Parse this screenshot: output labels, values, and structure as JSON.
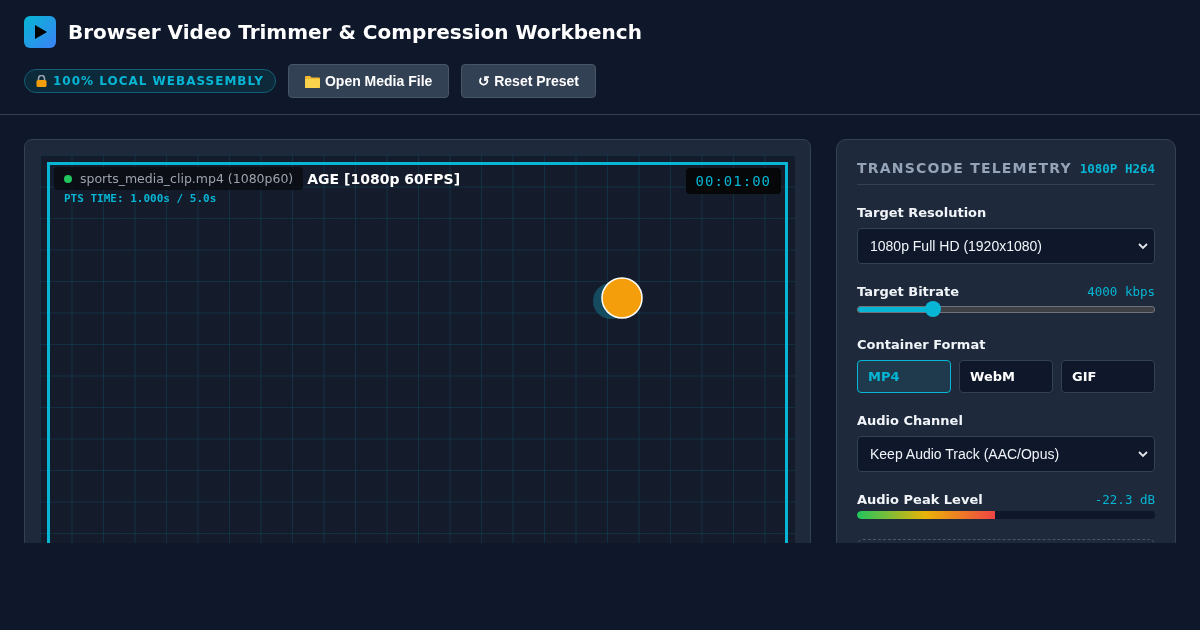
{
  "header": {
    "title": "Browser Video Trimmer & Compression Workbench",
    "badge": "100% LOCAL WEBASSEMBLY",
    "buttons": [
      {
        "kind": "open",
        "label": "Open Media File"
      },
      {
        "kind": "reset",
        "label": "↺ Reset Preset"
      }
    ]
  },
  "preview": {
    "filename": "sports_media_clip.mp4 (1080p60)",
    "caption_visible": "AGE [1080p 60FPS]",
    "pts": "PTS TIME: 1.000s / 5.0s",
    "timecode": "00:01:00"
  },
  "telemetry": {
    "title": "TRANSCODE TELEMETRY",
    "tag": "1080P H264",
    "resolution": {
      "label": "Target Resolution",
      "value": "1080p Full HD (1920x1080)"
    },
    "bitrate": {
      "label": "Target Bitrate",
      "reading": "4000 kbps",
      "level": 0.255
    },
    "container": {
      "label": "Container Format",
      "options": [
        {
          "label": "MP4",
          "selected": true
        },
        {
          "label": "WebM",
          "selected": false
        },
        {
          "label": "GIF",
          "selected": false
        }
      ]
    },
    "audio": {
      "label": "Audio Channel",
      "value": "Keep Audio Track (AAC/Opus)"
    },
    "peak": {
      "label": "Audio Peak Level",
      "reading": "-22.3 dB",
      "level": 0.463
    }
  }
}
